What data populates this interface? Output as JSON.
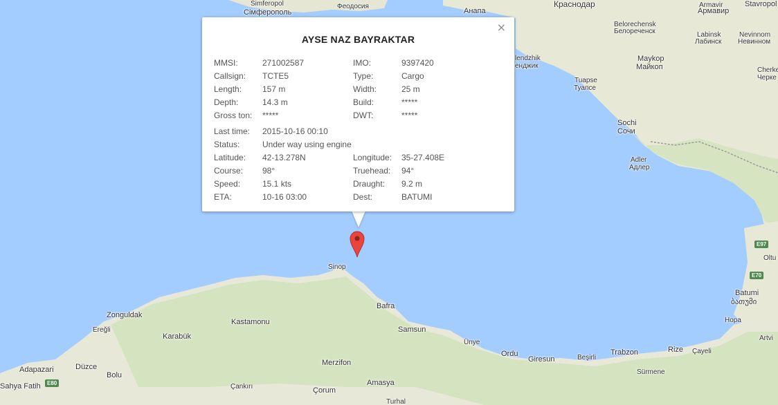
{
  "map": {
    "places": [
      {
        "name": "Simferopol",
        "cls": "sm"
      },
      {
        "name": "Сімферополь",
        "cls": "md"
      },
      {
        "name": "Феодосия",
        "cls": "sm"
      },
      {
        "name": "Анапа",
        "cls": "md"
      },
      {
        "name": "Краснодар",
        "cls": "lg"
      },
      {
        "name": "Armavir",
        "cls": "sm"
      },
      {
        "name": "Армавир",
        "cls": "md"
      },
      {
        "name": "Stavropol",
        "cls": "md"
      },
      {
        "name": "Belorechensk",
        "cls": "sm"
      },
      {
        "name": "Белореченск",
        "cls": "sm"
      },
      {
        "name": "Labinsk",
        "cls": "sm"
      },
      {
        "name": "Лабинск",
        "cls": "sm"
      },
      {
        "name": "Nevinnom",
        "cls": "sm"
      },
      {
        "name": "Невинном",
        "cls": "sm"
      },
      {
        "name": "Maykop",
        "cls": "md"
      },
      {
        "name": "Майкоп",
        "cls": "md"
      },
      {
        "name": "Cherke",
        "cls": "sm"
      },
      {
        "name": "Черке",
        "cls": "sm"
      },
      {
        "name": "lendzhik",
        "cls": "sm"
      },
      {
        "name": "енджик",
        "cls": "sm"
      },
      {
        "name": "Tuapse",
        "cls": "sm"
      },
      {
        "name": "Туапсе",
        "cls": "sm"
      },
      {
        "name": "Sochi",
        "cls": "md"
      },
      {
        "name": "Сочи",
        "cls": "md"
      },
      {
        "name": "Adler",
        "cls": "sm"
      },
      {
        "name": "Адлер",
        "cls": "sm"
      },
      {
        "name": "Batumi",
        "cls": "md"
      },
      {
        "name": "ბათუმი",
        "cls": "md"
      },
      {
        "name": "Hopa",
        "cls": "sm"
      },
      {
        "name": "Sinop",
        "cls": "sm"
      },
      {
        "name": "Zonguldak",
        "cls": "md"
      },
      {
        "name": "Ereğli",
        "cls": "sm"
      },
      {
        "name": "Kastamonu",
        "cls": "md"
      },
      {
        "name": "Karabük",
        "cls": "md"
      },
      {
        "name": "Bafra",
        "cls": "md"
      },
      {
        "name": "Samsun",
        "cls": "md"
      },
      {
        "name": "Ünye",
        "cls": "sm"
      },
      {
        "name": "Ordu",
        "cls": "md"
      },
      {
        "name": "Giresun",
        "cls": "md"
      },
      {
        "name": "Beşirli",
        "cls": "sm"
      },
      {
        "name": "Trabzon",
        "cls": "md"
      },
      {
        "name": "Rize",
        "cls": "md"
      },
      {
        "name": "Çayeli",
        "cls": "sm"
      },
      {
        "name": "Artvi",
        "cls": "sm"
      },
      {
        "name": "Sürmene",
        "cls": "sm"
      },
      {
        "name": "Düzce",
        "cls": "md"
      },
      {
        "name": "Adapazari",
        "cls": "md"
      },
      {
        "name": "Bolu",
        "cls": "md"
      },
      {
        "name": "Sahya Fatih",
        "cls": "md"
      },
      {
        "name": "Merzifon",
        "cls": "md"
      },
      {
        "name": "Çankırı",
        "cls": "sm"
      },
      {
        "name": "Çorum",
        "cls": "md"
      },
      {
        "name": "Amasya",
        "cls": "md"
      },
      {
        "name": "Turhal",
        "cls": "sm"
      },
      {
        "name": "Oltu",
        "cls": "sm"
      }
    ],
    "highways": [
      "E97",
      "E70",
      "E80"
    ]
  },
  "popup": {
    "title": "AYSE NAZ BAYRAKTAR",
    "close_label": "×",
    "left_rows": [
      {
        "label": "MMSI:",
        "value": "271002587"
      },
      {
        "label": "Callsign:",
        "value": "TCTE5"
      },
      {
        "label": "Length:",
        "value": "157 m"
      },
      {
        "label": "Depth:",
        "value": "14.3 m"
      },
      {
        "label": "Gross ton:",
        "value": "*****"
      }
    ],
    "right_rows": [
      {
        "label": "IMO:",
        "value": "9397420"
      },
      {
        "label": "Type:",
        "value": "Cargo"
      },
      {
        "label": "Width:",
        "value": "25 m"
      },
      {
        "label": "Build:",
        "value": "*****"
      },
      {
        "label": "DWT:",
        "value": "*****"
      }
    ],
    "last_time": {
      "label": "Last time:",
      "value": "2015-10-16 00:10"
    },
    "status": {
      "label": "Status:",
      "value": "Under way using engine"
    },
    "left_rows2": [
      {
        "label": "Latitude:",
        "value": "42-13.278N"
      },
      {
        "label": "Course:",
        "value": "98°"
      },
      {
        "label": "Speed:",
        "value": "15.1 kts"
      },
      {
        "label": "ETA:",
        "value": "10-16 03:00"
      }
    ],
    "right_rows2": [
      {
        "label": "Longitude:",
        "value": "35-27.408E"
      },
      {
        "label": "Truehead:",
        "value": "94°"
      },
      {
        "label": "Draught:",
        "value": "9.2 m"
      },
      {
        "label": "Dest:",
        "value": "BATUMI"
      }
    ]
  },
  "colors": {
    "sea": "#a3ccff",
    "land": "#eceade",
    "land_green": "#cfe3b8",
    "marker": "#e8453c"
  }
}
